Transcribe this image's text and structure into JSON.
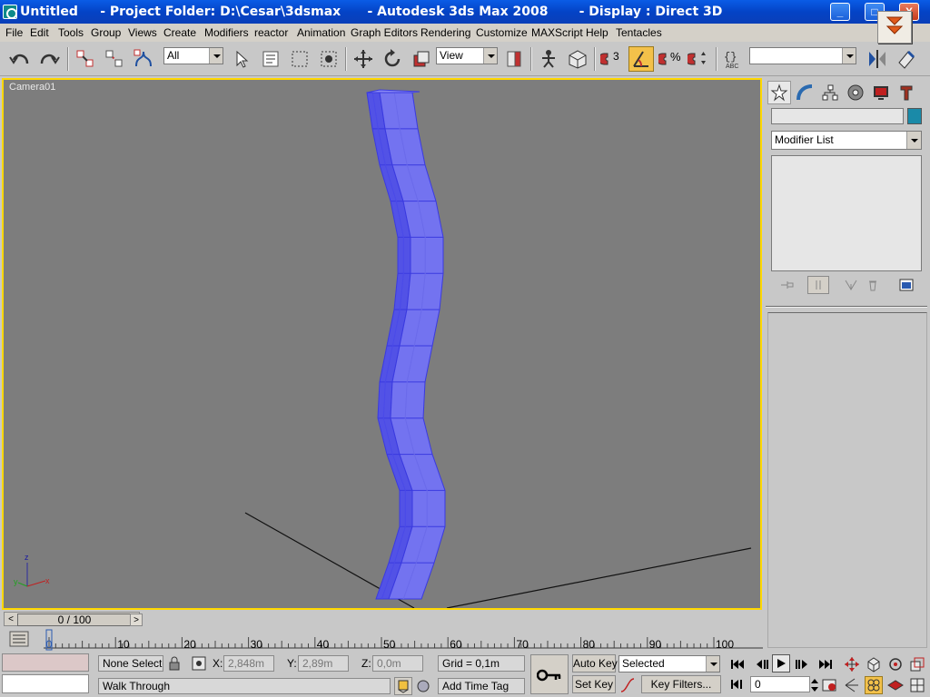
{
  "window": {
    "title": "Untitled     - Project Folder: D:\\Cesar\\3dsmax      - Autodesk 3ds Max 2008       - Display : Direct 3D",
    "min_glyph": "_",
    "max_glyph": "□",
    "close_glyph": "X"
  },
  "menu": [
    "File",
    "Edit",
    "Tools",
    "Group",
    "Views",
    "Create",
    "Modifiers",
    "reactor",
    "Animation",
    "Graph Editors",
    "Rendering",
    "Customize",
    "MAXScript",
    "Help",
    "Tentacles"
  ],
  "toolbar": {
    "selection_filter": "All",
    "reference_coord": "View",
    "snap_number": "3",
    "named_selection": ""
  },
  "viewport": {
    "label": "Camera01",
    "axes": {
      "x": "x",
      "y": "y",
      "z": "z"
    },
    "object_color": "#7373f0",
    "object_edge_color": "#3a3ae0",
    "object_segments": 14
  },
  "command_panel": {
    "tabs": [
      "create-icon",
      "modify-icon",
      "hierarchy-icon",
      "motion-icon",
      "display-icon",
      "utilities-icon"
    ],
    "active_tab": "create-icon",
    "object_name": "",
    "object_color": "#1a8aa8",
    "modifier_list": "Modifier List"
  },
  "time_slider": {
    "position_label": "0 / 100",
    "prev_glyph": "<",
    "next_glyph": ">",
    "current_frame": 0,
    "total_frames": 100
  },
  "track_bar": {
    "ticks": [
      "0",
      "10",
      "20",
      "30",
      "40",
      "50",
      "60",
      "70",
      "80",
      "90",
      "100"
    ]
  },
  "status": {
    "selection": "None Selecte",
    "prompt": "Walk Through",
    "x_label": "X:",
    "x_value": "2,848m",
    "y_label": "Y:",
    "y_value": "2,89m",
    "z_label": "Z:",
    "z_value": "0,0m",
    "grid": "Grid = 0,1m",
    "add_time_tag": "Add Time Tag",
    "auto_key": "Auto Key",
    "set_key": "Set Key",
    "key_mode": "Selected",
    "key_filters": "Key Filters...",
    "frame_value": "0"
  }
}
